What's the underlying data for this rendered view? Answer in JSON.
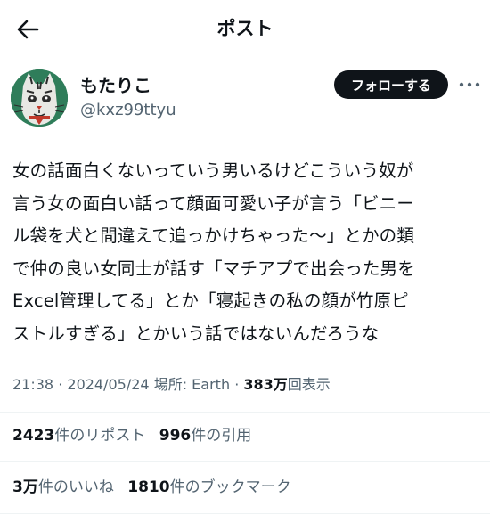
{
  "header": {
    "title": "ポスト",
    "back_icon": "arrow-left-icon"
  },
  "author": {
    "name": "もたりこ",
    "handle": "@kxz99ttyu",
    "follow_label": "フォローする",
    "more_icon": "more-horizontal-icon"
  },
  "tweet": {
    "lines": [
      "女の話面白くないっていう男いるけどこういう奴が",
      "言う女の面白い話って顔面可愛い子が言う「ビニー",
      "ル袋を犬と間違えて追っかけちゃった〜」とかの類",
      "で仲の良い女同士が話す「マチアプで出会った男を",
      "Excel管理してる」とか「寝起きの私の顔が竹原ピ",
      "ストルすぎる」とかいう話ではないんだろうな"
    ]
  },
  "meta": {
    "time": "21:38",
    "dot": "·",
    "date": "2024/05/24",
    "location": "場所: Earth",
    "views_count": "383万",
    "views_label": "回表示"
  },
  "stats": {
    "reposts_count": "2423",
    "reposts_label": "件のリポスト",
    "quotes_count": "996",
    "quotes_label": "件の引用",
    "likes_count": "3万",
    "likes_label": "件のいいね",
    "bookmarks_count": "1810",
    "bookmarks_label": "件のブックマーク"
  },
  "colors": {
    "text": "#0f1419",
    "secondary": "#536471",
    "border": "#eff3f4",
    "button": "#0f1419"
  }
}
